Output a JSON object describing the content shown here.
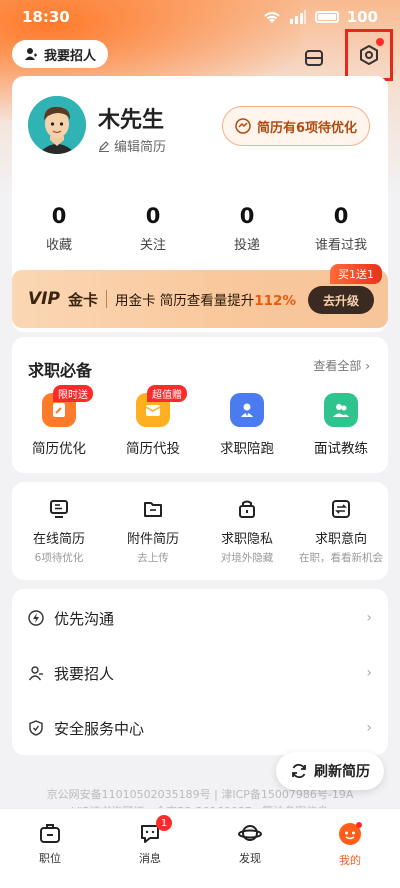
{
  "status_bar": {
    "time": "18:30",
    "battery": "100"
  },
  "header": {
    "recruit_pill": "我要招人"
  },
  "profile": {
    "name": "木先生",
    "edit_label": "编辑简历",
    "resume_optimize": "简历有6项待优化",
    "stats": [
      {
        "num": "0",
        "label": "收藏"
      },
      {
        "num": "0",
        "label": "关注"
      },
      {
        "num": "0",
        "label": "投递"
      },
      {
        "num": "0",
        "label": "谁看过我"
      }
    ]
  },
  "vip": {
    "logo": "VIP",
    "card": "金卡",
    "text": "用金卡 简历查看量提升",
    "pct": "112%",
    "upgrade": "去升级",
    "badge": "买1送1"
  },
  "job_section": {
    "title": "求职必备",
    "see_all": "查看全部",
    "items": [
      {
        "label": "简历优化",
        "badge": "限时送",
        "color": "#ff7a2a"
      },
      {
        "label": "简历代投",
        "badge": "超值赠",
        "color": "#ffb020"
      },
      {
        "label": "求职陪跑",
        "badge": "",
        "color": "#4a7cf0"
      },
      {
        "label": "面试教练",
        "badge": "",
        "color": "#2fc48d"
      }
    ]
  },
  "resume_section": {
    "items": [
      {
        "label": "在线简历",
        "sub": "6项待优化"
      },
      {
        "label": "附件简历",
        "sub": "去上传"
      },
      {
        "label": "求职隐私",
        "sub": "对境外隐藏"
      },
      {
        "label": "求职意向",
        "sub": "在职，看看新机会"
      }
    ]
  },
  "menu": {
    "items": [
      {
        "label": "优先沟通",
        "icon": "lightning-icon"
      },
      {
        "label": "我要招人",
        "icon": "person-icon"
      },
      {
        "label": "安全服务中心",
        "icon": "shield-icon"
      }
    ]
  },
  "refresh": "刷新简历",
  "icp": {
    "line1": "京公网安备11010502035189号 | 津ICP备15007986号-19A",
    "line2": "VIP证书许可证：合字B2-20160087 · 算法备案信息"
  },
  "tabs": [
    {
      "label": "职位",
      "badge": ""
    },
    {
      "label": "消息",
      "badge": "1"
    },
    {
      "label": "发现",
      "badge": ""
    },
    {
      "label": "我的",
      "badge": ""
    }
  ],
  "colors": {
    "accent": "#ff5e1a",
    "highlight": "#e8261a"
  }
}
